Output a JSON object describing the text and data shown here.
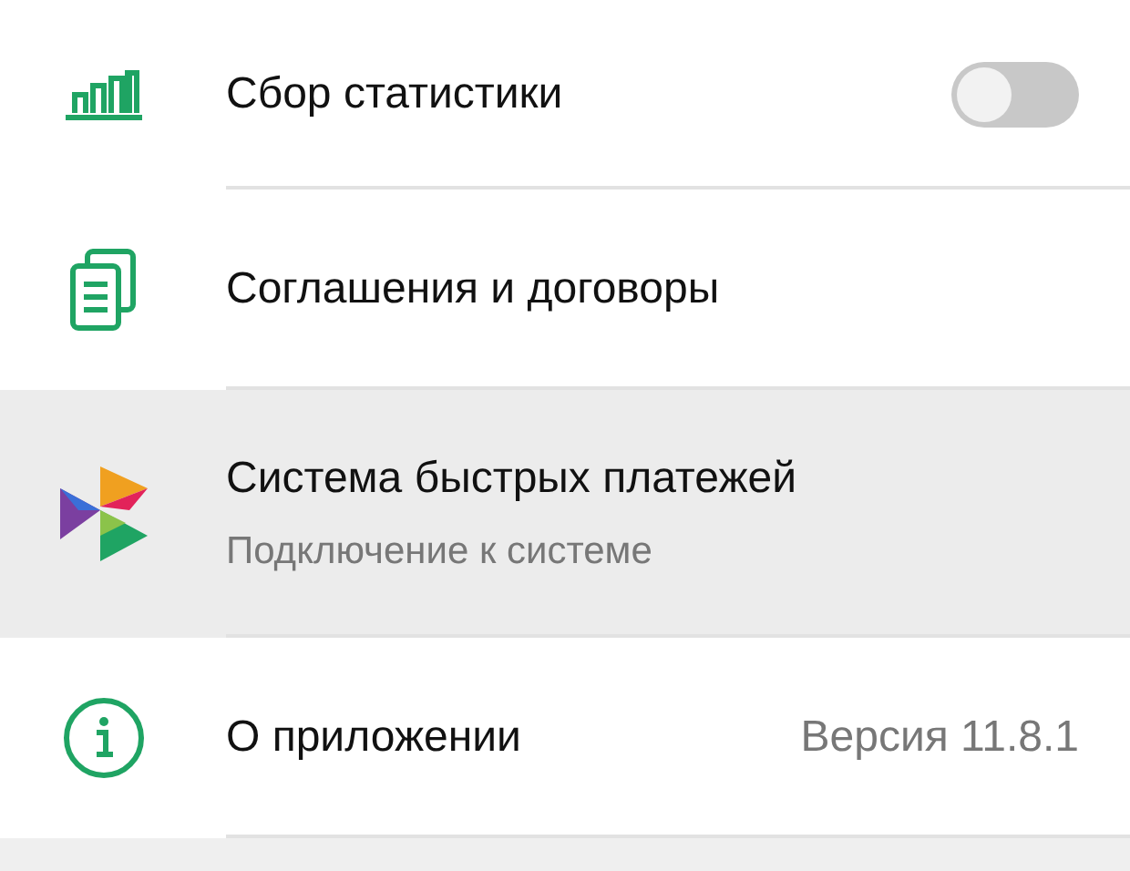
{
  "settings": [
    {
      "kind": "toggle",
      "title": "Сбор статистики",
      "on": false,
      "selected": false
    },
    {
      "kind": "plain",
      "title": "Соглашения и договоры",
      "selected": false
    },
    {
      "kind": "subtitle",
      "title": "Система быстрых платежей",
      "subtitle": "Подключение к системе",
      "selected": true
    },
    {
      "kind": "value",
      "title": "О приложении",
      "value": "Версия 11.8.1",
      "selected": false
    }
  ]
}
